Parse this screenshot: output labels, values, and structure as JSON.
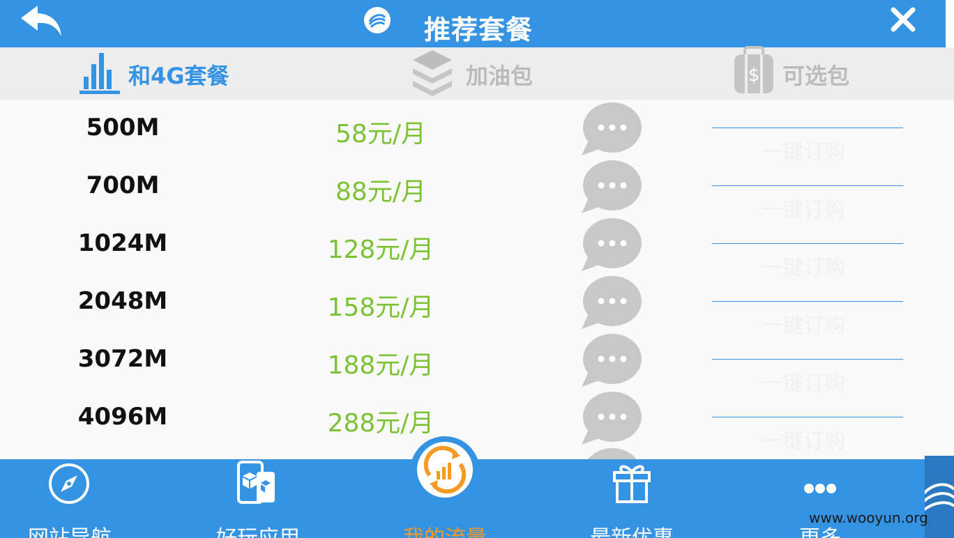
{
  "header": {
    "title": "推荐套餐",
    "back_icon": "back-arrow-icon",
    "close_icon": "close-icon",
    "logo_icon": "china-mobile-logo-icon"
  },
  "tabs": [
    {
      "label": "和4G套餐",
      "icon": "bar-chart-icon",
      "active": true
    },
    {
      "label": "加油包",
      "icon": "layers-icon",
      "active": false
    },
    {
      "label": "可选包",
      "icon": "money-bag-icon",
      "active": false
    }
  ],
  "plans": [
    {
      "size": "500M",
      "price": "58元/月",
      "action": "一键订购"
    },
    {
      "size": "700M",
      "price": "88元/月",
      "action": "一键订购"
    },
    {
      "size": "1024M",
      "price": "128元/月",
      "action": "一键订购"
    },
    {
      "size": "2048M",
      "price": "158元/月",
      "action": "一键订购"
    },
    {
      "size": "3072M",
      "price": "188元/月",
      "action": "一键订购"
    },
    {
      "size": "4096M",
      "price": "288元/月",
      "action": "一键订购"
    }
  ],
  "bottom_nav": [
    {
      "label": "网站导航",
      "icon": "compass-icon"
    },
    {
      "label": "好玩应用",
      "icon": "apps-phone-icon"
    },
    {
      "label": "我的流量",
      "icon": "data-usage-icon",
      "active": true
    },
    {
      "label": "最新优惠",
      "icon": "gift-icon"
    },
    {
      "label": "更多",
      "icon": "more-dots-icon"
    }
  ],
  "watermark": "www.wooyun.org",
  "colors": {
    "primary": "#3593e3",
    "price": "#7bc234",
    "active_nav": "#f59a23",
    "tab_bg": "#eeedee"
  }
}
